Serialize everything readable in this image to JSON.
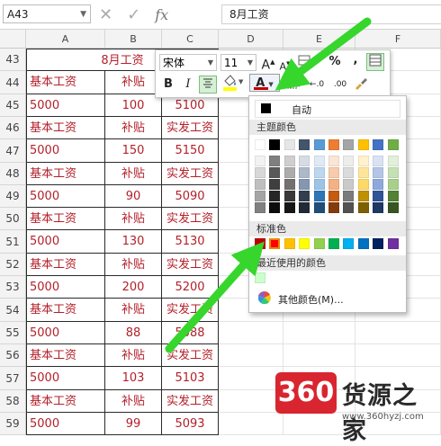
{
  "formula_bar": {
    "name_box": "A43",
    "cancel_glyph": "✕",
    "enter_glyph": "✓",
    "fx_glyph": "fx",
    "formula": "8月工资"
  },
  "columns": [
    "A",
    "B",
    "C",
    "D",
    "E",
    "F"
  ],
  "rows": [
    {
      "num": "43",
      "cells": [
        "",
        "8月工资",
        ""
      ]
    },
    {
      "num": "44",
      "cells": [
        "基本工资",
        "补贴",
        "实发工资"
      ]
    },
    {
      "num": "45",
      "cells": [
        "5000",
        "100",
        "5100"
      ]
    },
    {
      "num": "46",
      "cells": [
        "基本工资",
        "补贴",
        "实发工资"
      ]
    },
    {
      "num": "47",
      "cells": [
        "5000",
        "150",
        "5150"
      ]
    },
    {
      "num": "48",
      "cells": [
        "基本工资",
        "补贴",
        "实发工资"
      ]
    },
    {
      "num": "49",
      "cells": [
        "5000",
        "90",
        "5090"
      ]
    },
    {
      "num": "50",
      "cells": [
        "基本工资",
        "补贴",
        "实发工资"
      ]
    },
    {
      "num": "51",
      "cells": [
        "5000",
        "130",
        "5130"
      ]
    },
    {
      "num": "52",
      "cells": [
        "基本工资",
        "补贴",
        "实发工资"
      ]
    },
    {
      "num": "53",
      "cells": [
        "5000",
        "200",
        "5200"
      ]
    },
    {
      "num": "54",
      "cells": [
        "基本工资",
        "补贴",
        "实发工资"
      ]
    },
    {
      "num": "55",
      "cells": [
        "5000",
        "88",
        "5088"
      ]
    },
    {
      "num": "56",
      "cells": [
        "基本工资",
        "补贴",
        "实发工资"
      ]
    },
    {
      "num": "57",
      "cells": [
        "5000",
        "103",
        "5103"
      ]
    },
    {
      "num": "58",
      "cells": [
        "基本工资",
        "补贴",
        "实发工资"
      ]
    },
    {
      "num": "59",
      "cells": [
        "5000",
        "99",
        "5093"
      ]
    }
  ],
  "mini_toolbar": {
    "font_name": "宋体",
    "font_size": "11",
    "grow_font": "A",
    "shrink_font": "A",
    "percent": "%",
    "comma": ",",
    "bold": "B",
    "italic": "I",
    "font_color_letter": "A",
    "increase_decimal": "←.0",
    "decrease_decimal": ".00",
    "font_color_current": "#c00000",
    "highlight_color": "#ffff00"
  },
  "color_palette": {
    "automatic_label": "自动",
    "theme_header": "主题颜色",
    "standard_header": "标准色",
    "recent_header": "最近使用的颜色",
    "more_colors_label": "其他颜色(M)...",
    "automatic_color": "#000000",
    "theme_top": [
      "#ffffff",
      "#000000",
      "#e7e6e6",
      "#44546a",
      "#5b9bd5",
      "#ed7d31",
      "#a5a5a5",
      "#ffc000",
      "#4472c4",
      "#70ad47"
    ],
    "theme_shades": [
      [
        "#f2f2f2",
        "#7f7f7f",
        "#d0cece",
        "#d6dce4",
        "#deebf6",
        "#fbe5d5",
        "#ededed",
        "#fff2cc",
        "#dae3f3",
        "#e2efd9"
      ],
      [
        "#d8d8d8",
        "#595959",
        "#aeabab",
        "#adb9ca",
        "#bdd7ee",
        "#f7cbac",
        "#dbdbdb",
        "#fee599",
        "#b4c6e7",
        "#c5e0b3"
      ],
      [
        "#bfbfbf",
        "#3f3f3f",
        "#757070",
        "#8496b0",
        "#9dc3e6",
        "#f4b183",
        "#c9c9c9",
        "#ffd965",
        "#8eaadb",
        "#a8d08d"
      ],
      [
        "#a5a5a5",
        "#262626",
        "#3a3838",
        "#323f4f",
        "#2e75b5",
        "#c55a11",
        "#7b7b7b",
        "#bf9000",
        "#2f5496",
        "#538135"
      ],
      [
        "#7f7f7f",
        "#0c0c0c",
        "#171616",
        "#222a35",
        "#1e4e79",
        "#833c0b",
        "#525252",
        "#7f6000",
        "#1f3864",
        "#375623"
      ]
    ],
    "standard": [
      "#c00000",
      "#ff0000",
      "#ffc000",
      "#ffff00",
      "#92d050",
      "#00b050",
      "#00b0f0",
      "#0070c0",
      "#002060",
      "#7030a0"
    ],
    "recent": [
      "#ccffcc"
    ]
  },
  "watermark": {
    "badge": "360",
    "name": "货源之家",
    "url": "www.360hyzj.com"
  },
  "arrow_color": "#36d62c"
}
